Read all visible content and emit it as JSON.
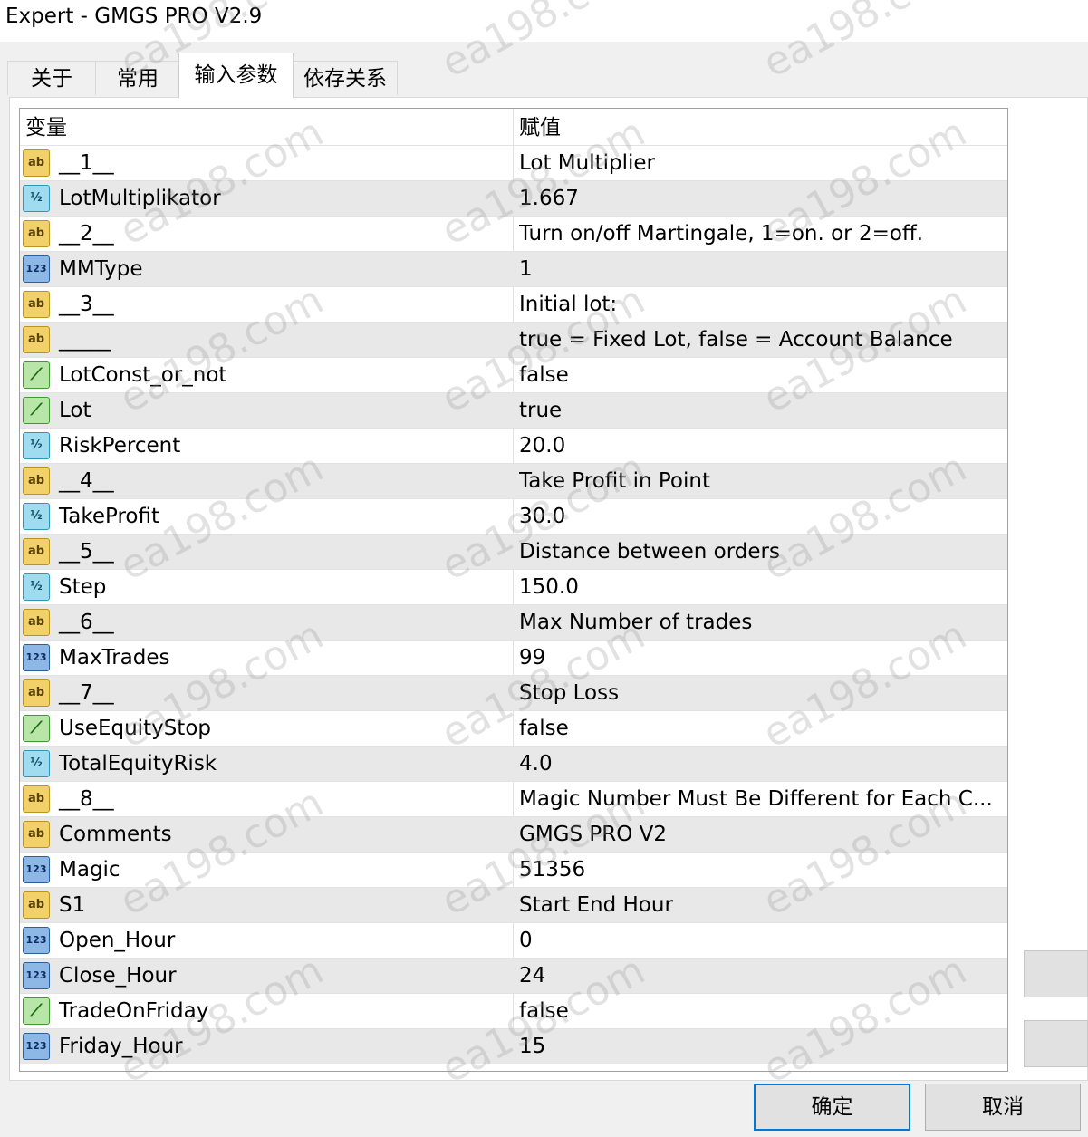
{
  "window": {
    "title": "Expert - GMGS PRO V2.9"
  },
  "tabs": [
    {
      "label": "关于"
    },
    {
      "label": "常用"
    },
    {
      "label": "输入参数"
    },
    {
      "label": "依存关系"
    }
  ],
  "grid": {
    "columns": {
      "variable": "变量",
      "value": "赋值"
    },
    "rows": [
      {
        "icon": "ab",
        "name": "__1__",
        "value": "Lot Multiplier"
      },
      {
        "icon": "half",
        "name": "LotMultiplikator",
        "value": "1.667"
      },
      {
        "icon": "ab",
        "name": "__2__",
        "value": " Turn on/off Martingale,  1=on. or 2=off."
      },
      {
        "icon": "num",
        "name": "MMType",
        "value": "1"
      },
      {
        "icon": "ab",
        "name": "__3__",
        "value": "Initial lot:"
      },
      {
        "icon": "ab",
        "name": "_____",
        "value": "true  =  Fixed Lot, false  =  Account Balance"
      },
      {
        "icon": "bool",
        "name": "LotConst_or_not",
        "value": "false"
      },
      {
        "icon": "bool",
        "name": "Lot",
        "value": "true"
      },
      {
        "icon": "half",
        "name": "RiskPercent",
        "value": "20.0"
      },
      {
        "icon": "ab",
        "name": "__4__",
        "value": "Take Profit in Point"
      },
      {
        "icon": "half",
        "name": "TakeProfit",
        "value": "30.0"
      },
      {
        "icon": "ab",
        "name": "__5__",
        "value": "Distance between orders"
      },
      {
        "icon": "half",
        "name": "Step",
        "value": "150.0"
      },
      {
        "icon": "ab",
        "name": "__6__",
        "value": "Max Number of trades"
      },
      {
        "icon": "num",
        "name": "MaxTrades",
        "value": "99"
      },
      {
        "icon": "ab",
        "name": "__7__",
        "value": "Stop Loss"
      },
      {
        "icon": "bool",
        "name": "UseEquityStop",
        "value": "false"
      },
      {
        "icon": "half",
        "name": "TotalEquityRisk",
        "value": "4.0"
      },
      {
        "icon": "ab",
        "name": "__8__",
        "value": "Magic Number Must Be Different for Each C..."
      },
      {
        "icon": "ab",
        "name": "Comments",
        "value": "GMGS PRO V2"
      },
      {
        "icon": "num",
        "name": "Magic",
        "value": "51356"
      },
      {
        "icon": "ab",
        "name": "S1",
        "value": " Start End Hour"
      },
      {
        "icon": "num",
        "name": "Open_Hour",
        "value": "0"
      },
      {
        "icon": "num",
        "name": "Close_Hour",
        "value": "24"
      },
      {
        "icon": "bool",
        "name": "TradeOnFriday",
        "value": "false"
      },
      {
        "icon": "num",
        "name": "Friday_Hour",
        "value": "15"
      }
    ]
  },
  "icons": {
    "ab": "ab",
    "half": "½",
    "num": "123",
    "bool": "⟋"
  },
  "buttons": {
    "ok": "确定",
    "cancel": "取消"
  },
  "watermark": "ea198.com"
}
